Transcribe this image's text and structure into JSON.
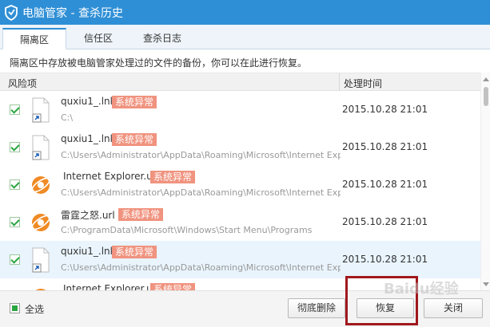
{
  "window": {
    "title": "电脑管家 - 查杀历史"
  },
  "tabs": [
    {
      "label": "隔离区",
      "active": true
    },
    {
      "label": "信任区",
      "active": false
    },
    {
      "label": "查杀日志",
      "active": false
    }
  ],
  "description": "隔离区中存放被电脑管家处理过的文件的备份，你可以在此进行恢复。",
  "columns": {
    "risk_item": "风险项",
    "time": "处理时间"
  },
  "rows": [
    {
      "name": "quxiu1_.lnk",
      "badge": "系统异常",
      "path": "C:\\",
      "time": "2015.10.28 21:01",
      "checked": true,
      "icon": "shortcut-file-icon"
    },
    {
      "name": "quxiu1_.lnk",
      "badge": "系统异常",
      "path": "C:\\Users\\Administrator\\AppData\\Roaming\\Microsoft\\Internet Explorer\\Qu",
      "time": "2015.10.28 21:01",
      "checked": true,
      "icon": "shortcut-file-icon"
    },
    {
      "name": "Internet Explorer.url",
      "badge": "系统异常",
      "path": "C:\\Users\\Administrator\\AppData\\Roaming\\Microsoft\\Internet Explorer\\Qu",
      "time": "2015.10.28 21:01",
      "checked": true,
      "icon": "url-file-icon"
    },
    {
      "name": "雷霆之怒.url",
      "badge": "系统异常",
      "path": "C:\\ProgramData\\Microsoft\\Windows\\Start Menu\\Programs",
      "time": "2015.10.28 21:01",
      "checked": true,
      "icon": "url-file-icon"
    },
    {
      "name": "quxiu1_.lnk",
      "badge": "系统异常",
      "path": "C:\\Users\\Administrator\\AppData\\Roaming\\Microsoft\\Internet Explorer\\Qu",
      "time": "2015.10.28 21:01",
      "checked": true,
      "icon": "shortcut-file-icon"
    },
    {
      "name": "Internet Explorer.url",
      "badge": "系统异常",
      "path": "",
      "time": "",
      "checked": true,
      "icon": "url-file-icon"
    }
  ],
  "footer": {
    "select_all": "全选",
    "delete_button": "彻底删除",
    "restore_button": "恢复",
    "close_button": "关闭"
  },
  "watermark": "Baidu经验",
  "colors": {
    "titlebar": "#2f8fd6",
    "badge": "#f0937f",
    "check": "#2aa640",
    "highlight": "#a0181d"
  }
}
